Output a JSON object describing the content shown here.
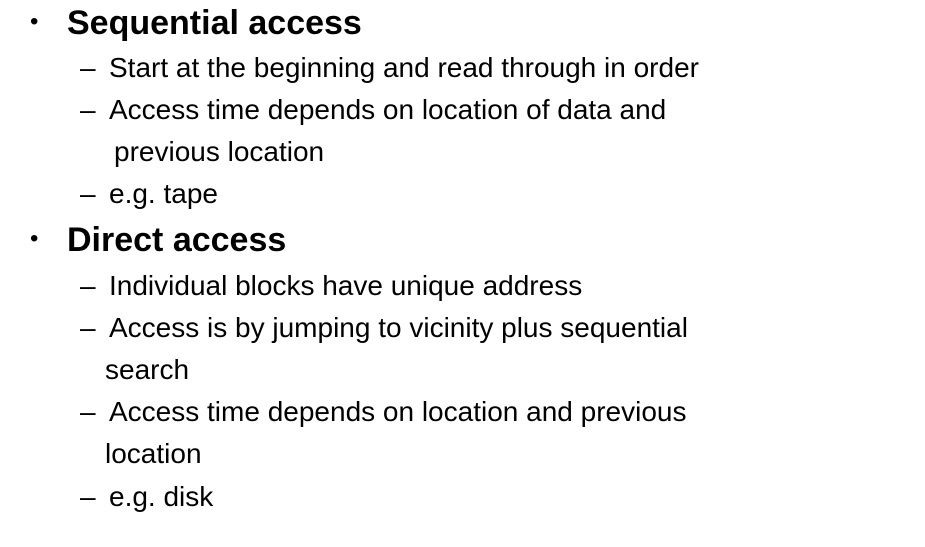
{
  "sections": [
    {
      "heading": "Sequential access",
      "items": [
        {
          "line1": "Start at the beginning and read through in order"
        },
        {
          "line1": "Access time depends on location of data and",
          "line2": "previous location"
        },
        {
          "line1": "e.g. tape"
        }
      ]
    },
    {
      "heading": "Direct access",
      "items": [
        {
          "line1": "Individual blocks have unique address"
        },
        {
          "line1": "Access is by jumping to vicinity plus sequential",
          "line2": "search"
        },
        {
          "line1": "Access time depends on location and previous",
          "line2": "location"
        },
        {
          "line1": "e.g. disk"
        }
      ]
    }
  ],
  "glyphs": {
    "bullet": "•",
    "dash": "–"
  }
}
